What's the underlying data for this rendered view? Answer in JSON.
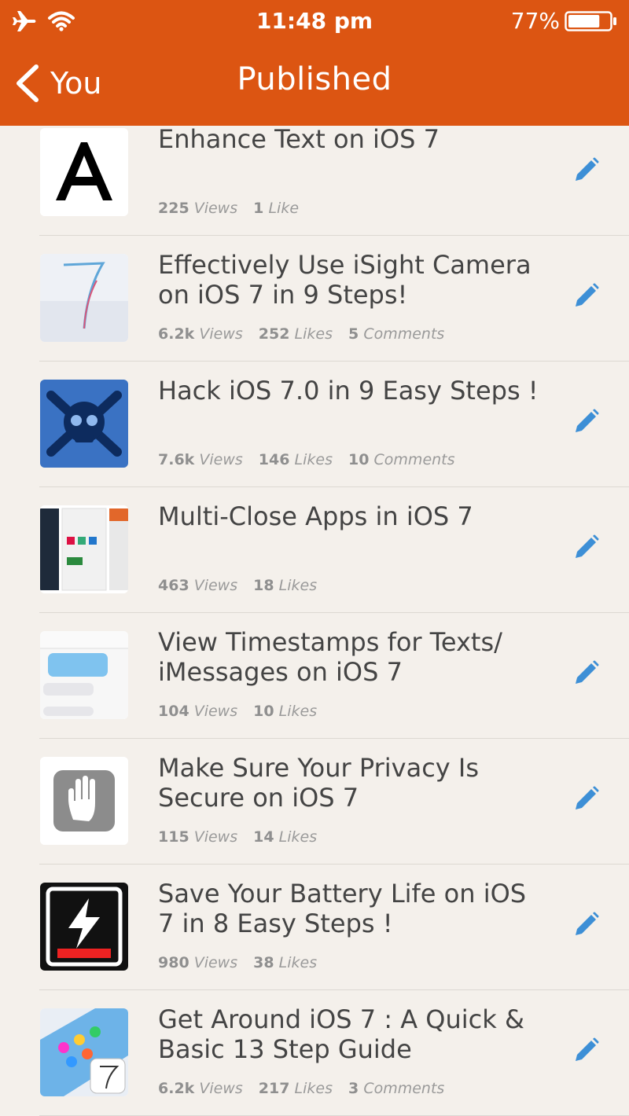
{
  "status_bar": {
    "time": "11:48 pm",
    "battery_percent": "77%",
    "battery_level": 0.77,
    "icons": [
      "airplane-icon",
      "wifi-icon",
      "battery-icon"
    ]
  },
  "nav": {
    "back_label": "You",
    "title": "Published"
  },
  "colors": {
    "header": "#dc5512",
    "background": "#f4f0eb",
    "edit_icon": "#3d8fd6"
  },
  "items": [
    {
      "title": "Enhance Text on iOS 7",
      "thumb": "letter-a",
      "views": "225",
      "views_label": "Views",
      "likes": "1",
      "likes_label": "Like"
    },
    {
      "title": "Effectively Use iSight Camera on iOS 7 in 9 Steps!",
      "thumb": "ios7-seven",
      "views": "6.2k",
      "views_label": "Views",
      "likes": "252",
      "likes_label": "Likes",
      "comments": "5",
      "comments_label": "Comments"
    },
    {
      "title": "Hack iOS 7.0 in 9 Easy Steps !",
      "thumb": "skull",
      "views": "7.6k",
      "views_label": "Views",
      "likes": "146",
      "likes_label": "Likes",
      "comments": "10",
      "comments_label": "Comments"
    },
    {
      "title": "Multi-Close Apps in iOS 7",
      "thumb": "multitask",
      "views": "463",
      "views_label": "Views",
      "likes": "18",
      "likes_label": "Likes"
    },
    {
      "title": "View Timestamps for Texts/ iMessages on iOS 7",
      "thumb": "messages",
      "views": "104",
      "views_label": "Views",
      "likes": "10",
      "likes_label": "Likes"
    },
    {
      "title": "Make Sure Your Privacy Is Secure on iOS 7",
      "thumb": "privacy-hand",
      "views": "115",
      "views_label": "Views",
      "likes": "14",
      "likes_label": "Likes"
    },
    {
      "title": "Save Your Battery Life on iOS 7 in 8 Easy Steps !",
      "thumb": "battery-bolt",
      "views": "980",
      "views_label": "Views",
      "likes": "38",
      "likes_label": "Likes"
    },
    {
      "title": "Get Around iOS 7 : A Quick & Basic 13 Step Guide",
      "thumb": "ios7-homescreen",
      "views": "6.2k",
      "views_label": "Views",
      "likes": "217",
      "likes_label": "Likes",
      "comments": "3",
      "comments_label": "Comments"
    }
  ]
}
